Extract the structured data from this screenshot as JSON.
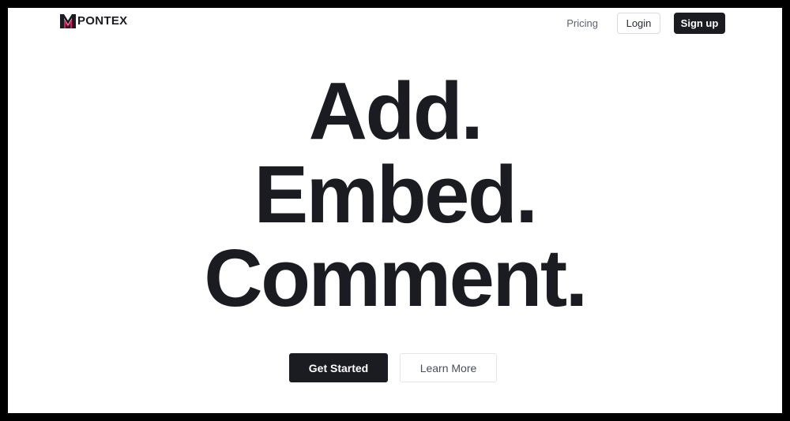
{
  "brand": {
    "name": "PONTEX",
    "logo_icon": "pontex-logo-icon",
    "logo_colors": [
      "#1b1c22",
      "#e0185a"
    ]
  },
  "nav": {
    "pricing_label": "Pricing",
    "login_label": "Login",
    "signup_label": "Sign up"
  },
  "hero": {
    "lines": [
      "Add.",
      "Embed.",
      "Comment."
    ]
  },
  "cta": {
    "primary_label": "Get Started",
    "secondary_label": "Learn More"
  },
  "colors": {
    "text_dark": "#1b1c22",
    "muted": "#5d6474",
    "border": "#d9dce2",
    "background": "#ffffff",
    "frame": "#000000"
  }
}
